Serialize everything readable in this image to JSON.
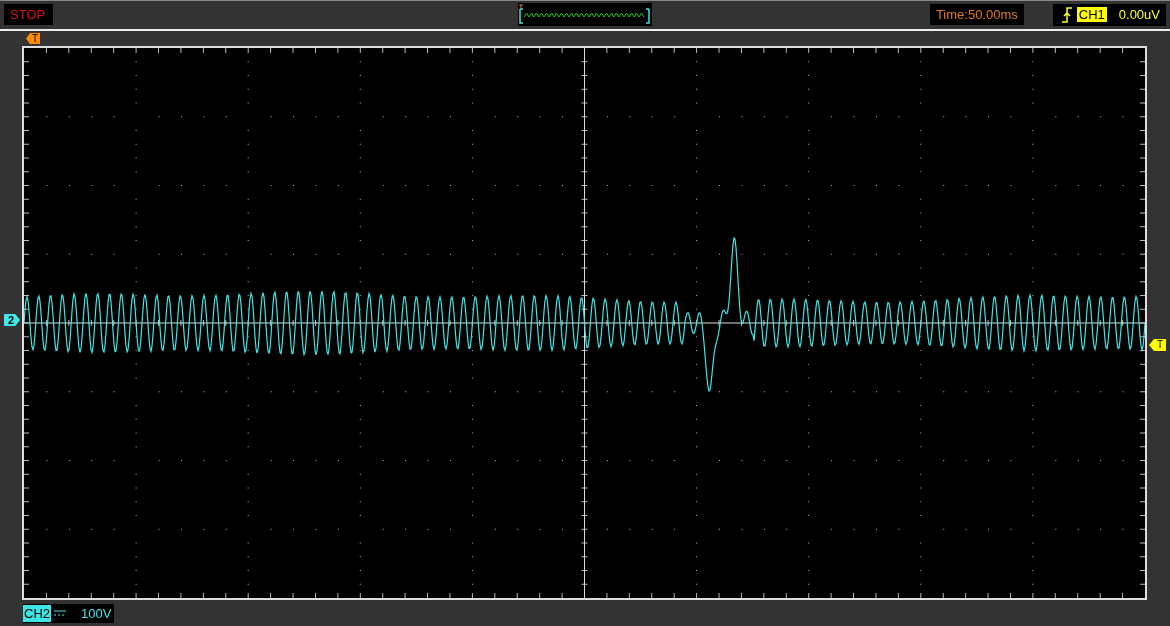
{
  "status": "STOP",
  "timebase": "Time:50.00ms",
  "trigger": {
    "channel": "CH1",
    "level": "0.00uV",
    "marker": "T"
  },
  "time_marker": "T",
  "channel": {
    "name": "CH2",
    "marker": "2",
    "scale": "100V"
  }
}
